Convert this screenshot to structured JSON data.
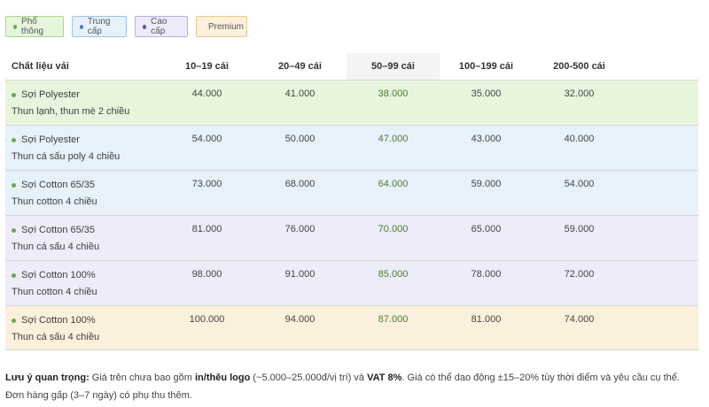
{
  "legend": [
    {
      "label": "Phổ thông",
      "color": "#6aa84f"
    },
    {
      "label": "Trung cấp",
      "color": "#3d85c6"
    },
    {
      "label": "Cao cấp",
      "color": "#5b4fa8"
    },
    {
      "label": "Premium",
      "color": "#d9963c"
    }
  ],
  "table": {
    "headers": [
      "Chất liệu vải",
      "10–19 cái",
      "20–49 cái",
      "50–99 cái",
      "100–199 cái",
      "200-500 cái"
    ],
    "rows": [
      {
        "material": "Sợi Polyester",
        "fabric": "Thun lạnh, thun mè 2 chiều",
        "prices": [
          "44.000",
          "41.000",
          "38.000",
          "35.000",
          "32.000"
        ]
      },
      {
        "material": "Sợi Polyester",
        "fabric": "Thun cá sấu poly 4 chiều",
        "prices": [
          "54.000",
          "50.000",
          "47.000",
          "43.000",
          "40.000"
        ]
      },
      {
        "material": "Sợi Cotton 65/35",
        "fabric": "Thun cotton 4 chiều",
        "prices": [
          "73.000",
          "68.000",
          "64.000",
          "59.000",
          "54.000"
        ]
      },
      {
        "material": "Sợi Cotton 65/35",
        "fabric": "Thun cá sấu 4 chiều",
        "prices": [
          "81.000",
          "76.000",
          "70.000",
          "65.000",
          "59.000"
        ]
      },
      {
        "material": "Sợi Cotton 100%",
        "fabric": "Thun cotton 4 chiều",
        "prices": [
          "98.000",
          "91.000",
          "85.000",
          "78.000",
          "72.000"
        ]
      },
      {
        "material": "Sợi Cotton 100%",
        "fabric": "Thun cá sấu 4 chiều",
        "prices": [
          "100.000",
          "94.000",
          "87.000",
          "81.000",
          "74.000"
        ]
      }
    ]
  },
  "note": {
    "prefix": "Lưu ý quan trọng:",
    "t1": " Giá trên chưa bao gồm ",
    "b1": "in/thêu logo",
    "t2": " (~5.000–25.000đ/vị trí) và ",
    "b2": "VAT 8%",
    "t3": ". Giá có thể dao động ±15–20% tùy thời điểm và yêu cầu cụ thể. Đơn hàng gấp (3–7 ngày) có phụ thu thêm."
  }
}
